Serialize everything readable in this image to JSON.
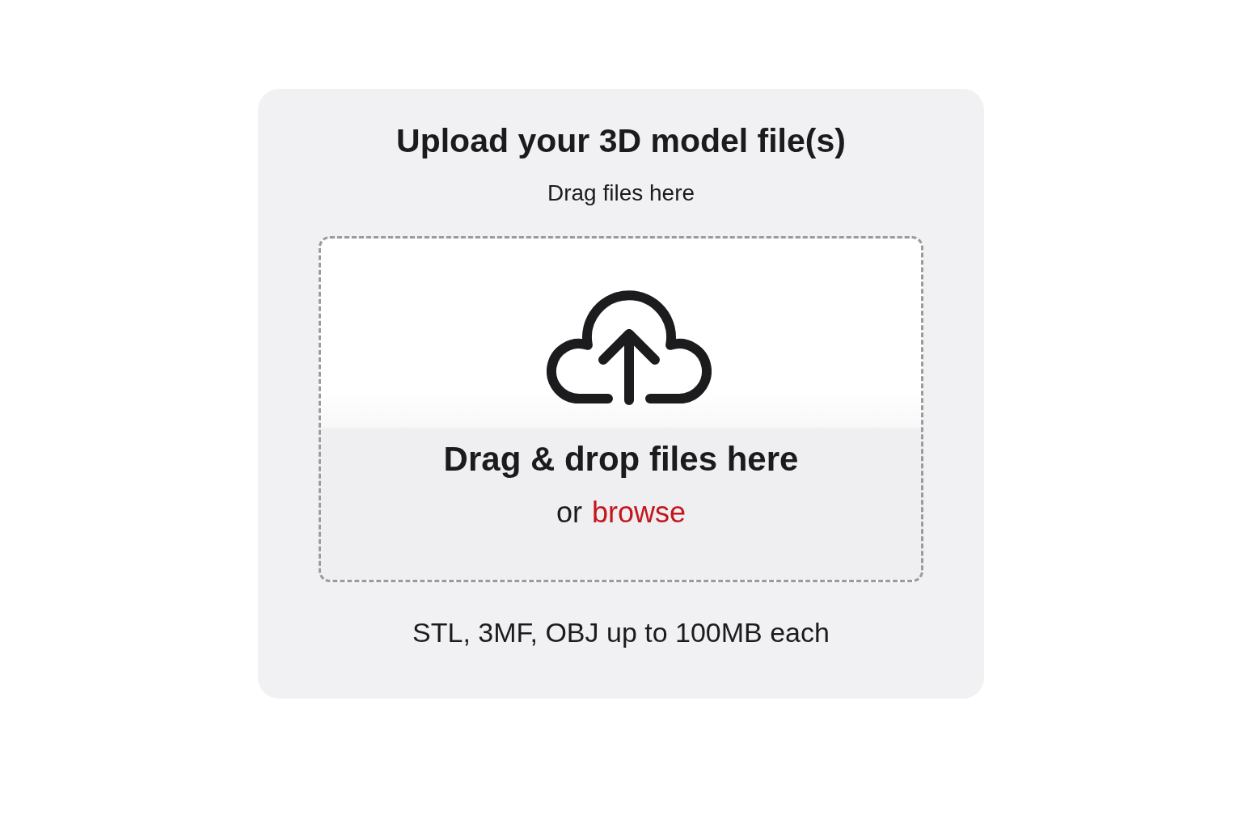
{
  "upload_card": {
    "title": "Upload your 3D model file(s)",
    "subtitle": "Drag files here",
    "drop_zone": {
      "heading": "Drag & drop files here",
      "prompt": "or",
      "link": "browse"
    },
    "footer_note": "STL, 3MF, OBJ up to 100MB each"
  }
}
